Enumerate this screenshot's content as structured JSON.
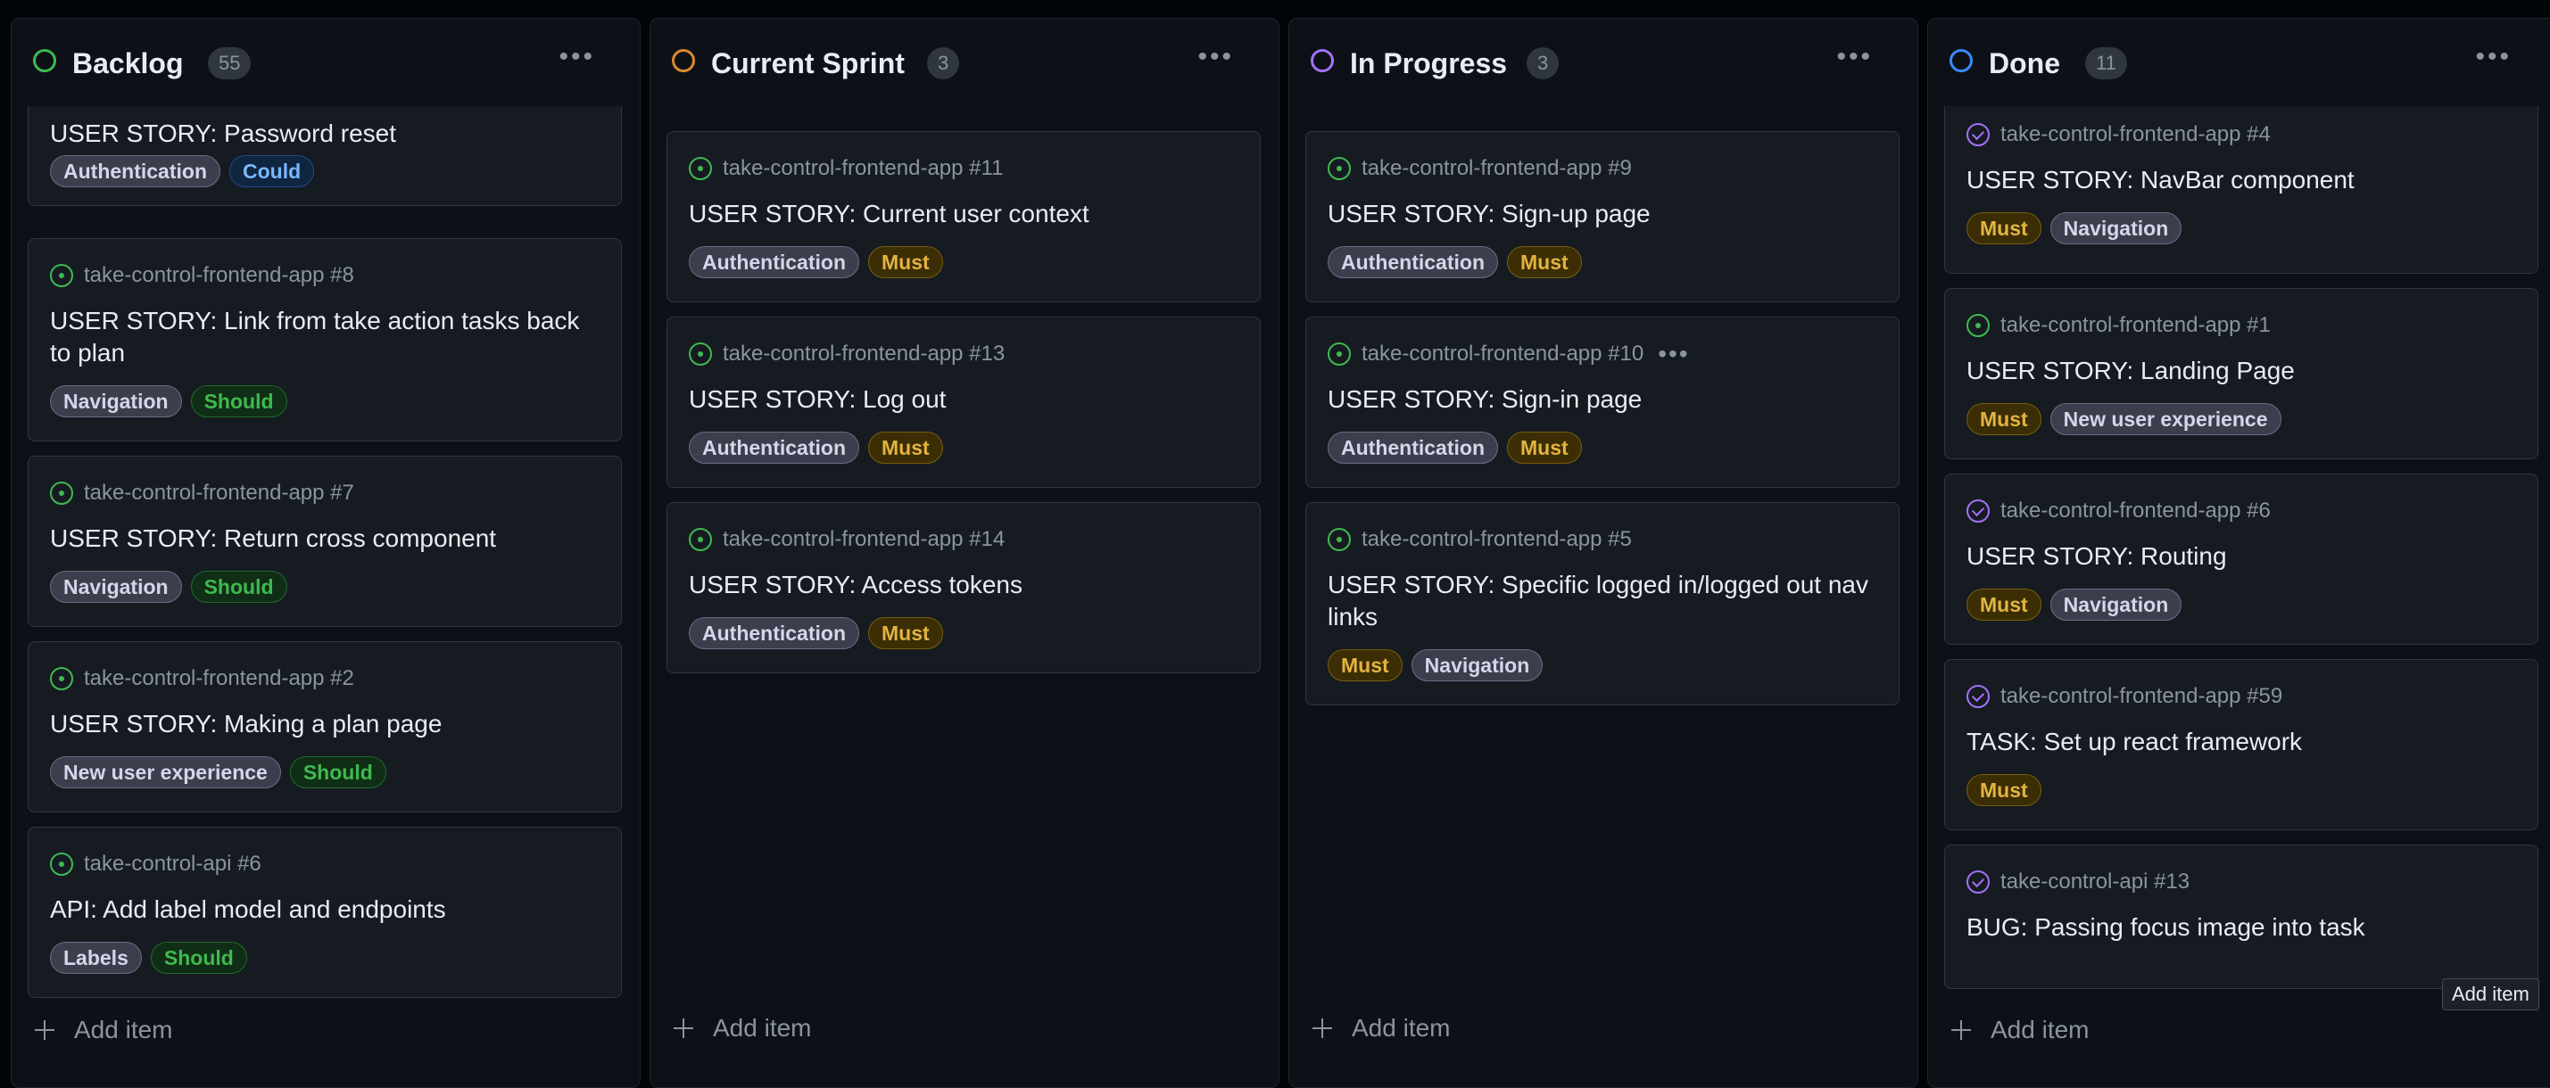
{
  "columns": [
    {
      "title": "Backlog",
      "count": "55",
      "status_color": "#3fb950",
      "add_item": "Add item",
      "cards": [
        {
          "ref": "",
          "state": "open",
          "title": "USER STORY: Password reset",
          "labels": [
            {
              "text": "Authentication",
              "color": "gray"
            },
            {
              "text": "Could",
              "color": "blue"
            }
          ]
        },
        {
          "ref": "take-control-frontend-app #8",
          "state": "open",
          "title": "USER STORY: Link from take action tasks back to plan",
          "labels": [
            {
              "text": "Navigation",
              "color": "gray"
            },
            {
              "text": "Should",
              "color": "green"
            }
          ]
        },
        {
          "ref": "take-control-frontend-app #7",
          "state": "open",
          "title": "USER STORY: Return cross component",
          "labels": [
            {
              "text": "Navigation",
              "color": "gray"
            },
            {
              "text": "Should",
              "color": "green"
            }
          ]
        },
        {
          "ref": "take-control-frontend-app #2",
          "state": "open",
          "title": "USER STORY: Making a plan page",
          "labels": [
            {
              "text": "New user experience",
              "color": "gray"
            },
            {
              "text": "Should",
              "color": "green"
            }
          ]
        },
        {
          "ref": "take-control-api #6",
          "state": "open",
          "title": "API: Add label model and endpoints",
          "labels": [
            {
              "text": "Labels",
              "color": "gray"
            },
            {
              "text": "Should",
              "color": "green"
            }
          ]
        }
      ]
    },
    {
      "title": "Current Sprint",
      "count": "3",
      "status_color": "#db8a2b",
      "add_item": "Add item",
      "cards": [
        {
          "ref": "take-control-frontend-app #11",
          "state": "open",
          "title": "USER STORY: Current user context",
          "labels": [
            {
              "text": "Authentication",
              "color": "gray"
            },
            {
              "text": "Must",
              "color": "yellow"
            }
          ]
        },
        {
          "ref": "take-control-frontend-app #13",
          "state": "open",
          "title": "USER STORY: Log out",
          "labels": [
            {
              "text": "Authentication",
              "color": "gray"
            },
            {
              "text": "Must",
              "color": "yellow"
            }
          ]
        },
        {
          "ref": "take-control-frontend-app #14",
          "state": "open",
          "title": "USER STORY: Access tokens",
          "labels": [
            {
              "text": "Authentication",
              "color": "gray"
            },
            {
              "text": "Must",
              "color": "yellow"
            }
          ]
        }
      ]
    },
    {
      "title": "In Progress",
      "count": "3",
      "status_color": "#a371f7",
      "add_item": "Add item",
      "cards": [
        {
          "ref": "take-control-frontend-app #9",
          "state": "open",
          "title": "USER STORY: Sign-up page",
          "labels": [
            {
              "text": "Authentication",
              "color": "gray"
            },
            {
              "text": "Must",
              "color": "yellow"
            }
          ]
        },
        {
          "ref": "take-control-frontend-app #10",
          "state": "open",
          "title": "USER STORY: Sign-in page",
          "menu": "•••",
          "labels": [
            {
              "text": "Authentication",
              "color": "gray"
            },
            {
              "text": "Must",
              "color": "yellow"
            }
          ]
        },
        {
          "ref": "take-control-frontend-app #5",
          "state": "open",
          "title": "USER STORY: Specific logged in/logged out nav links",
          "labels": [
            {
              "text": "Must",
              "color": "yellow"
            },
            {
              "text": "Navigation",
              "color": "gray"
            }
          ]
        }
      ]
    },
    {
      "title": "Done",
      "count": "11",
      "status_color": "#388bfd",
      "add_item": "Add item",
      "cards": [
        {
          "ref": "take-control-frontend-app #4",
          "state": "closed",
          "title": "USER STORY: NavBar component",
          "labels": [
            {
              "text": "Must",
              "color": "yellow"
            },
            {
              "text": "Navigation",
              "color": "gray"
            }
          ]
        },
        {
          "ref": "take-control-frontend-app #1",
          "state": "open",
          "title": "USER STORY: Landing Page",
          "labels": [
            {
              "text": "Must",
              "color": "yellow"
            },
            {
              "text": "New user experience",
              "color": "gray"
            }
          ]
        },
        {
          "ref": "take-control-frontend-app #6",
          "state": "closed",
          "title": "USER STORY: Routing",
          "labels": [
            {
              "text": "Must",
              "color": "yellow"
            },
            {
              "text": "Navigation",
              "color": "gray"
            }
          ]
        },
        {
          "ref": "take-control-frontend-app #59",
          "state": "closed",
          "title": "TASK: Set up react framework",
          "labels": [
            {
              "text": "Must",
              "color": "yellow"
            }
          ]
        },
        {
          "ref": "take-control-api #13",
          "state": "closed",
          "title": "BUG: Passing focus image into task",
          "labels": []
        }
      ]
    }
  ],
  "column_menu": "•••",
  "tooltip": "Add item"
}
